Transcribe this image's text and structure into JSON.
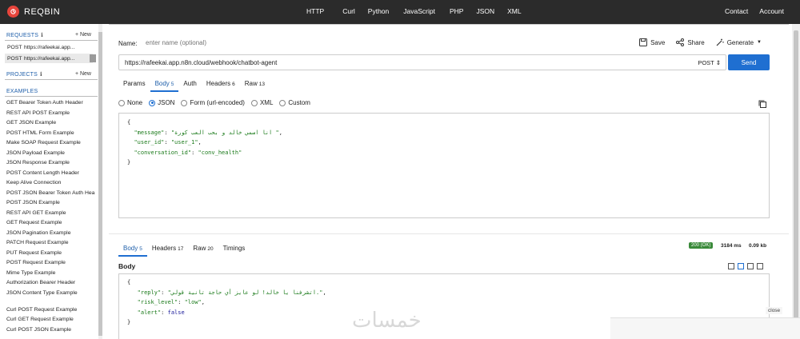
{
  "brand": {
    "name": "REQBIN"
  },
  "nav": {
    "items": [
      "HTTP",
      "Curl",
      "Python",
      "JavaScript",
      "PHP",
      "JSON",
      "XML"
    ],
    "right": [
      "Contact",
      "Account"
    ]
  },
  "sidebar": {
    "requests_label": "REQUESTS",
    "projects_label": "PROJECTS",
    "examples_label": "EXAMPLES",
    "new_label": "+ New",
    "requests": [
      {
        "method": "POST",
        "url": "https://rafeekai.app..."
      },
      {
        "method": "POST",
        "url": "https://rafeekai.app..."
      }
    ],
    "examples": [
      "GET Bearer Token Auth Header",
      "REST API POST Example",
      "GET JSON Example",
      "POST HTML Form Example",
      "Make SOAP Request Example",
      "JSON Payload Example",
      "JSON Response Example",
      "POST Content Length Header",
      "Keep Alive Connection",
      "POST JSON Bearer Token Auth Hea",
      "POST JSON Example",
      "REST API GET Example",
      "GET Request Example",
      "JSON Pagination Example",
      "PATCH Request Example",
      "PUT Request Example",
      "POST Request Example",
      "Mime Type Example",
      "Authorization Bearer Header",
      "JSON Content Type Example",
      "Curl POST Request Example",
      "Curl GET Request Example",
      "Curl POST JSON Example"
    ]
  },
  "request": {
    "name_label": "Name:",
    "name_placeholder": "enter name (optional)",
    "save_label": "Save",
    "share_label": "Share",
    "generate_label": "Generate",
    "url": "https://rafeekai.app.n8n.cloud/webhook/chatbot-agent",
    "method": "POST",
    "send_label": "Send",
    "tabs": [
      {
        "label": "Params",
        "count": ""
      },
      {
        "label": "Body",
        "count": "5"
      },
      {
        "label": "Auth",
        "count": ""
      },
      {
        "label": "Headers",
        "count": "6"
      },
      {
        "label": "Raw",
        "count": "13"
      }
    ],
    "body_types": [
      "None",
      "JSON",
      "Form (url-encoded)",
      "XML",
      "Custom"
    ],
    "body_json": {
      "open": "{",
      "close": "}",
      "lines": [
        {
          "key": "\"message\"",
          "value": "\"انا اسمي خالد و بحب العب كورة \"",
          "suffix": ","
        },
        {
          "key": "\"user_id\"",
          "value": "\"user_1\"",
          "suffix": ","
        },
        {
          "key": "\"conversation_id\"",
          "value": "\"conv_health\"",
          "suffix": ""
        }
      ]
    }
  },
  "response": {
    "tabs": [
      {
        "label": "Body",
        "count": "5"
      },
      {
        "label": "Headers",
        "count": "17"
      },
      {
        "label": "Raw",
        "count": "20"
      },
      {
        "label": "Timings",
        "count": ""
      }
    ],
    "status": "200 (OK)",
    "time": "3184 ms",
    "size": "0.09 kb",
    "body_label": "Body",
    "body_json": {
      "open": "{",
      "close": "}",
      "lines": [
        {
          "key": "\"reply\"",
          "value": "\"اتشرفنا يا خالد! لو عايز أي حاجة تانية قولي.\"",
          "suffix": ","
        },
        {
          "key": "\"risk_level\"",
          "value": "\"low\"",
          "suffix": ","
        },
        {
          "key": "\"alert\"",
          "value": "false",
          "suffix": ""
        }
      ]
    }
  },
  "overlay": {
    "close_label": "close"
  },
  "watermark": "خمسات"
}
